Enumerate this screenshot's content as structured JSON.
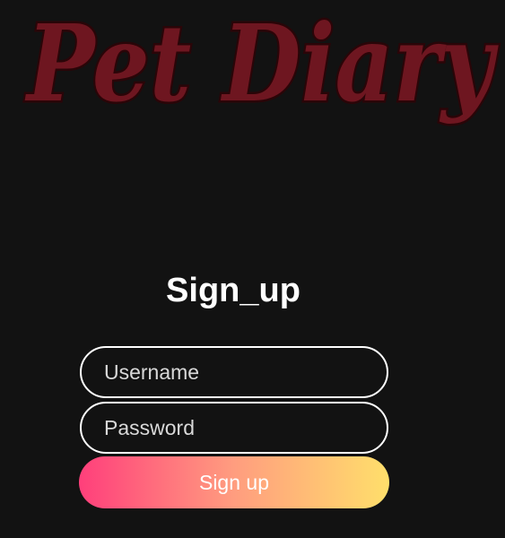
{
  "logo": {
    "text": "Pet Diary",
    "color": "#6e1620",
    "outline_color": "#3a0a0e"
  },
  "form": {
    "title": "Sign_up",
    "username_placeholder": "Username",
    "username_value": "",
    "password_placeholder": "Password",
    "password_value": "",
    "submit_label": "Sign up"
  },
  "colors": {
    "background": "#121212",
    "button_gradient_start": "#ff3f7b",
    "button_gradient_mid": "#ff9d7f",
    "button_gradient_end": "#ffdf6b",
    "field_border": "#ffffff"
  }
}
